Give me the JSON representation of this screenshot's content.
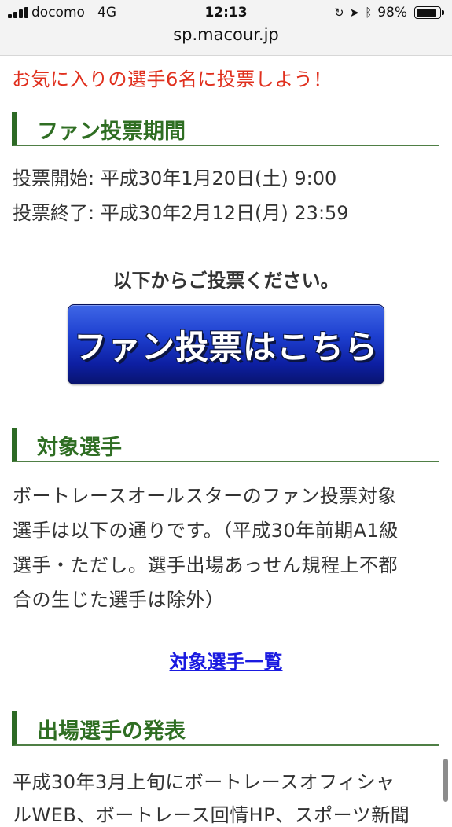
{
  "status_bar": {
    "carrier": "docomo",
    "network": "4G",
    "time": "12:13",
    "battery": "98%",
    "battery_level": 0.98
  },
  "browser": {
    "url": "sp.macour.jp"
  },
  "lead_text": "お気に入りの選手6名に投票しよう！",
  "sections": {
    "period": {
      "title": "ファン投票期間",
      "start": "投票開始: 平成30年1月20日(土) 9:00",
      "end": "投票終了: 平成30年2月12日(月) 23:59"
    },
    "vote": {
      "note": "以下からご投票ください。",
      "button_label": "ファン投票はこちら"
    },
    "targets": {
      "title": "対象選手",
      "lines": [
        "ボートレースオールスターのファン投票対象",
        "選手は以下の通りです。（平成30年前期A1級",
        "選手・ただし。選手出場あっせん規程上不都",
        "合の生じた選手は除外）"
      ],
      "link": "対象選手一覧"
    },
    "announcement": {
      "title": "出場選手の発表",
      "lines": [
        "平成30年3月上旬にボートレースオフィシャ",
        "ルWEB、ボートレース回情HP、スポーツ新聞"
      ]
    }
  },
  "colors": {
    "lead_red": "#e0301e",
    "heading_green": "#2f6e23",
    "button_blue": "#1d3fcf",
    "link_blue": "#1a1ae0"
  }
}
